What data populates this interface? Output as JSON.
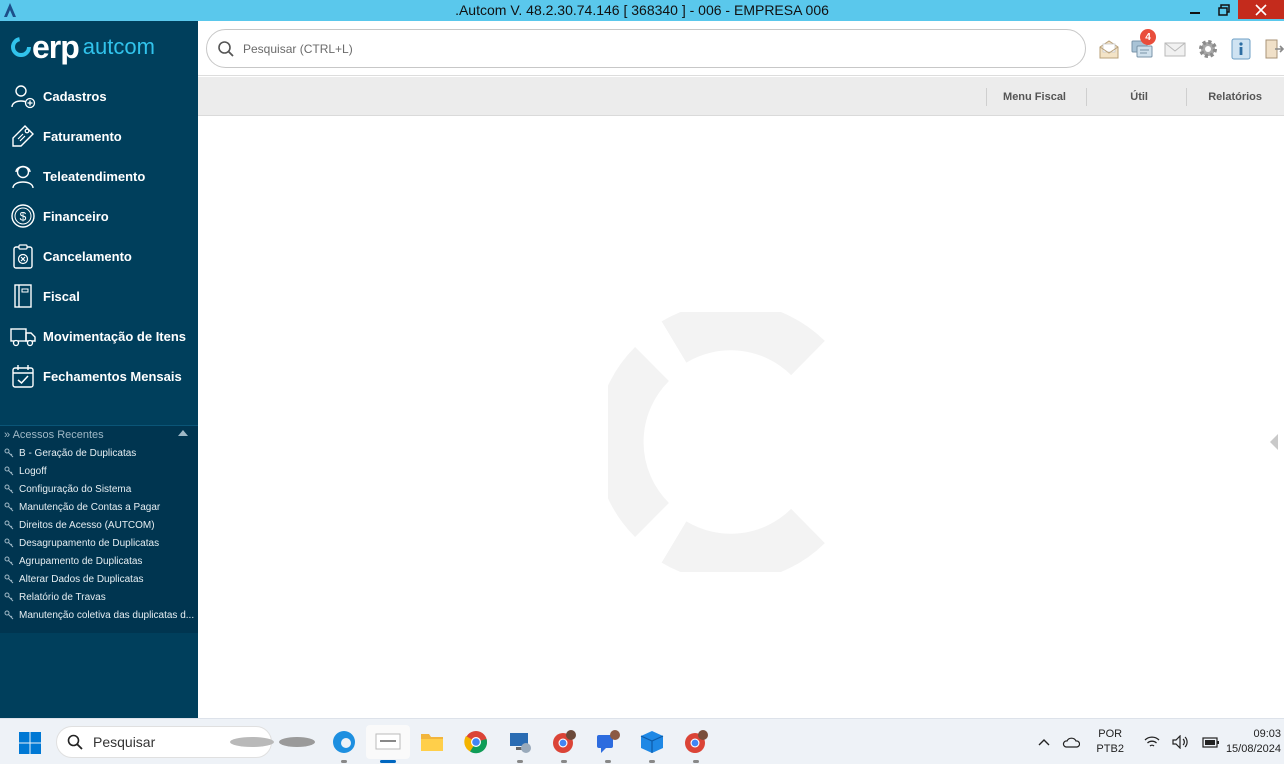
{
  "window": {
    "title": ".Autcom V. 48.2.30.74.146 [ 368340 ] - 006 - EMPRESA 006"
  },
  "logo": {
    "erp": "erp",
    "brand": "autcom"
  },
  "sidebar": {
    "items": [
      {
        "label": "Cadastros",
        "icon": "user-add-icon"
      },
      {
        "label": "Faturamento",
        "icon": "tag-icon"
      },
      {
        "label": "Teleatendimento",
        "icon": "headset-agent-icon"
      },
      {
        "label": "Financeiro",
        "icon": "dollar-coin-icon"
      },
      {
        "label": "Cancelamento",
        "icon": "clipboard-cancel-icon"
      },
      {
        "label": "Fiscal",
        "icon": "book-icon"
      },
      {
        "label": "Movimentação de Itens",
        "icon": "truck-icon"
      },
      {
        "label": "Fechamentos Mensais",
        "icon": "calendar-check-icon"
      }
    ],
    "recent": {
      "header": "» Acessos Recentes",
      "items": [
        "B - Geração de Duplicatas",
        "Logoff",
        "Configuração do Sistema",
        "Manutenção de Contas a Pagar",
        "Direitos de Acesso (AUTCOM)",
        "Desagrupamento de Duplicatas",
        "Agrupamento de Duplicatas",
        "Alterar Dados de Duplicatas",
        "Relatório de Travas",
        "Manutenção coletiva das duplicatas d..."
      ]
    }
  },
  "search": {
    "placeholder": "Pesquisar (CTRL+L)"
  },
  "toolbar": {
    "notifications_count": "4",
    "icons": [
      "open-mail-icon",
      "chat-icon",
      "mail-icon",
      "gear-icon",
      "info-icon",
      "exit-icon"
    ]
  },
  "menubar": {
    "items": [
      "Menu Fiscal",
      "Útil",
      "Relatórios"
    ]
  },
  "taskbar": {
    "search_label": "Pesquisar",
    "language": "POR",
    "keyboard": "PTB2",
    "time": "09:03",
    "date": "15/08/2024"
  },
  "colors": {
    "titlebar": "#5ac8ec",
    "sidebar": "#003f5c",
    "brand_accent": "#31c3ec",
    "badge": "#e94e3c"
  }
}
